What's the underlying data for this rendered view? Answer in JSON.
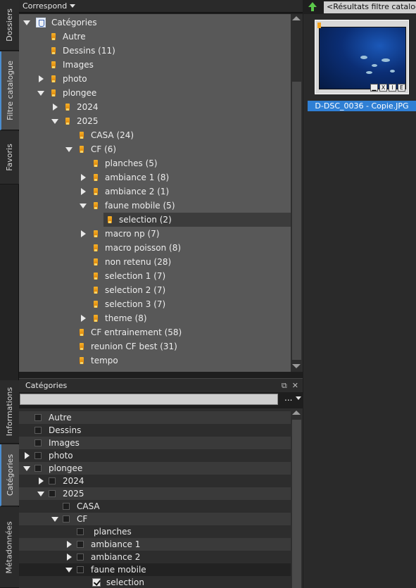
{
  "sidebar_tabs_top": [
    "Dossiers",
    "Filtre catalogue",
    "Favoris"
  ],
  "sidebar_tabs_bottom": [
    "Informations",
    "Catégories",
    "Métadonnées"
  ],
  "filter_panel": {
    "mode_label": "Correspond",
    "root_label": "Catégories",
    "items": [
      {
        "label": "Autre"
      },
      {
        "label": "Dessins (11)"
      },
      {
        "label": "Images"
      },
      {
        "label": "photo"
      },
      {
        "label": "plongee"
      },
      {
        "label": "2024"
      },
      {
        "label": "2025"
      },
      {
        "label": "CASA (24)"
      },
      {
        "label": "CF (6)"
      },
      {
        "label": "planches (5)"
      },
      {
        "label": "ambiance 1 (8)"
      },
      {
        "label": "ambiance 2 (1)"
      },
      {
        "label": "faune mobile (5)"
      },
      {
        "label": "selection (2)"
      },
      {
        "label": "macro np (7)"
      },
      {
        "label": "macro poisson (8)"
      },
      {
        "label": "non retenu (28)"
      },
      {
        "label": "selection 1 (7)"
      },
      {
        "label": "selection 2 (7)"
      },
      {
        "label": "selection 3 (7)"
      },
      {
        "label": "theme (8)"
      },
      {
        "label": "CF entrainement (58)"
      },
      {
        "label": "reunion CF best (31)"
      },
      {
        "label": "tempo"
      }
    ]
  },
  "results": {
    "tab_label": "<Résultats filtre catalogue",
    "thumbnail_caption": "D-DSC_0036 - Copie.JPG",
    "badges": [
      "X",
      "I",
      "E"
    ]
  },
  "categories_panel": {
    "title": "Catégories",
    "menu_label": "...",
    "items": [
      {
        "label": "Autre"
      },
      {
        "label": "Dessins"
      },
      {
        "label": "Images"
      },
      {
        "label": "photo"
      },
      {
        "label": "plongee"
      },
      {
        "label": "2024"
      },
      {
        "label": "2025"
      },
      {
        "label": "CASA"
      },
      {
        "label": "CF"
      },
      {
        "label": "planches"
      },
      {
        "label": "ambiance 1"
      },
      {
        "label": "ambiance 2"
      },
      {
        "label": "faune mobile"
      },
      {
        "label": "selection"
      }
    ]
  },
  "colors": {
    "accent": "#2f7fd4",
    "tag": "#f2a21e",
    "tree_bg": "#585858"
  }
}
